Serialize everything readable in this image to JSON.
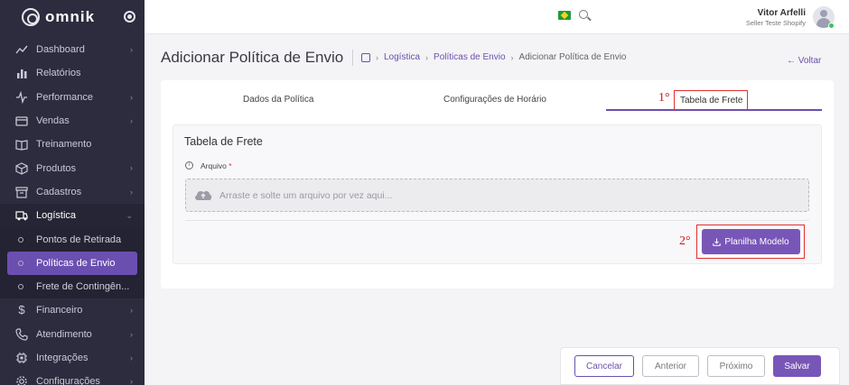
{
  "brand": {
    "name": "omnik"
  },
  "sidebar": {
    "items": [
      {
        "label": "Dashboard",
        "icon": "trend-icon",
        "has_children": true
      },
      {
        "label": "Relatórios",
        "icon": "bar-chart-icon",
        "has_children": false
      },
      {
        "label": "Performance",
        "icon": "pulse-icon",
        "has_children": true
      },
      {
        "label": "Vendas",
        "icon": "card-icon",
        "has_children": true
      },
      {
        "label": "Treinamento",
        "icon": "book-icon",
        "has_children": false
      },
      {
        "label": "Produtos",
        "icon": "box-icon",
        "has_children": true
      },
      {
        "label": "Cadastros",
        "icon": "archive-icon",
        "has_children": true
      },
      {
        "label": "Logística",
        "icon": "truck-icon",
        "has_children": true,
        "open": true
      },
      {
        "label": "Financeiro",
        "icon": "dollar-icon",
        "has_children": true
      },
      {
        "label": "Atendimento",
        "icon": "phone-icon",
        "has_children": true
      },
      {
        "label": "Integrações",
        "icon": "chip-icon",
        "has_children": true
      },
      {
        "label": "Configurações",
        "icon": "gear-icon",
        "has_children": true
      }
    ],
    "logistica_sub": [
      {
        "label": "Pontos de Retirada",
        "active": false
      },
      {
        "label": "Políticas de Envio",
        "active": true
      },
      {
        "label": "Frete de Contingên...",
        "active": false
      }
    ]
  },
  "topbar": {
    "user_name": "Vitor Arfelli",
    "user_role": "Seller Teste Shopify"
  },
  "header": {
    "title": "Adicionar Política de Envio",
    "breadcrumb": [
      "Logística",
      "Políticas de Envio",
      "Adicionar Política de Envio"
    ],
    "back_label": "Voltar"
  },
  "tabs": [
    {
      "label": "Dados da Política",
      "active": false
    },
    {
      "label": "Configurações de Horário",
      "active": false
    },
    {
      "label": "Tabela de Frete",
      "active": true
    }
  ],
  "annotations": {
    "step1": "1°",
    "step2": "2°"
  },
  "panel": {
    "title": "Tabela de Frete",
    "field_label": "Arquivo",
    "required_mark": "*",
    "dropzone_text": "Arraste e solte um arquivo por vez aqui...",
    "download_button": "Planilha Modelo"
  },
  "footer": {
    "cancel": "Cancelar",
    "previous": "Anterior",
    "next": "Próximo",
    "save": "Salvar"
  },
  "colors": {
    "accent": "#6b4fb0",
    "sidebar_bg": "#2c2c3e",
    "annotation": "#e03030"
  }
}
